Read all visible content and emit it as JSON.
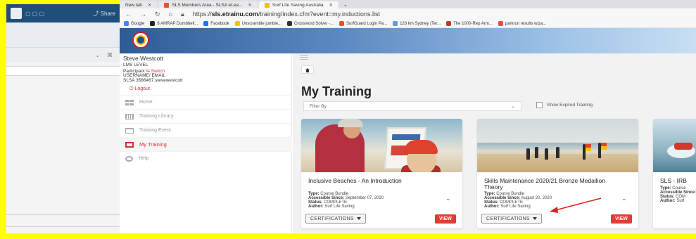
{
  "left_panel": {
    "share_label": "Share"
  },
  "browser": {
    "tabs": [
      {
        "label": "New tab"
      },
      {
        "label": "SLS Members Area - SLSA eLea..."
      },
      {
        "label": "Surf Life Saving Australia"
      }
    ],
    "url_prefix": "https://",
    "url_host": "sls.etrainu.com",
    "url_path": "/training/index.cfm?event=my.inductions.list",
    "bookmarks": [
      {
        "label": "Google",
        "color": "#4285f4"
      },
      {
        "label": "8 AMRAP Dumbbell...",
        "color": "#222222"
      },
      {
        "label": "Facebook",
        "color": "#1877f2"
      },
      {
        "label": "Unscramble jumble...",
        "color": "#f3c300"
      },
      {
        "label": "Crossword Solver -...",
        "color": "#333333"
      },
      {
        "label": "SurfGuard Login Pa...",
        "color": "#e2542b"
      },
      {
        "label": "128 km Sydney (Ter...",
        "color": "#5aa0d8"
      },
      {
        "label": "The 1000-Rep Arm...",
        "color": "#c0392b"
      },
      {
        "label": "parkrun results wiza...",
        "color": "#e84c3d"
      }
    ]
  },
  "sidebar": {
    "user_name": "Steve Westcott",
    "lms_level": "LMS LEVEL",
    "participant": "Participant",
    "switch_label": "Switch",
    "username_label": "USERNAME/ EMAIL",
    "username_value": "SLSA 3586467.stevewestcott",
    "logout": "Logout",
    "menu": [
      {
        "label": "Home",
        "icon": "grid-icon",
        "active": false
      },
      {
        "label": "Training Library",
        "icon": "library-icon",
        "active": false
      },
      {
        "label": "Training Event",
        "icon": "calendar-icon",
        "active": false
      },
      {
        "label": "My Training",
        "icon": "certificate-icon",
        "active": true
      },
      {
        "label": "Help",
        "icon": "help-icon",
        "active": false
      }
    ]
  },
  "main": {
    "page_title": "My Training",
    "filter_placeholder": "Filter By",
    "show_expired": "Show Expired Training",
    "certifications_label": "CERTIFICATIONS",
    "view_label": "VIEW",
    "field_labels": {
      "type": "Type:",
      "since": "Accessible Since:",
      "status": "Status:",
      "author": "Author:"
    },
    "cards": [
      {
        "title": "Inclusive Beaches - An Introduction",
        "type": "Course Bundle",
        "accessible_since": "September 07, 2020",
        "status": "COMPLETE",
        "author": "Surf Life Saving"
      },
      {
        "title": "Skills Maintenance 2020/21 Bronze Medallion Theory",
        "type": "Course Bundle",
        "accessible_since": "August 20, 2020",
        "status": "COMPLETE",
        "author": "Surf Life Saving"
      },
      {
        "title": "SLS - IRB",
        "type": "Course",
        "accessible_since": "S",
        "status": "COM",
        "author": "Surf"
      }
    ]
  },
  "annotation": {
    "arrow_color": "#e02020"
  },
  "frame_color": "#ffff00"
}
